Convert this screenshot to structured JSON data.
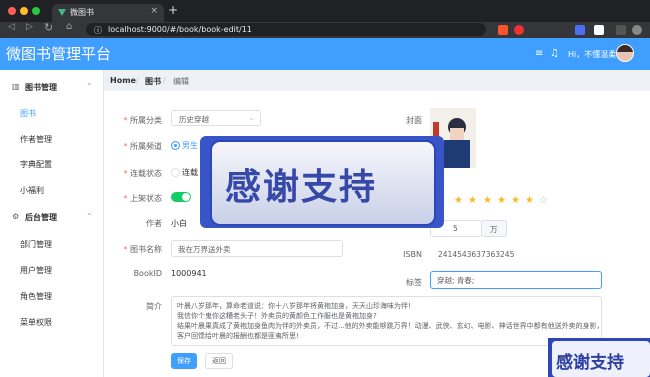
{
  "browser": {
    "tab_title": "微图书",
    "url": "localhost:9000/#/book/book-edit/11"
  },
  "header": {
    "brand": "微图书管理平台",
    "greeting": "Hi，不懂温柔"
  },
  "sidebar": {
    "groups": [
      {
        "title": "图书管理",
        "items": [
          "图书",
          "作者管理",
          "字典配置",
          "小福利"
        ]
      },
      {
        "title": "后台管理",
        "items": [
          "部门管理",
          "用户管理",
          "角色管理",
          "菜单权限"
        ]
      }
    ]
  },
  "breadcrumb": {
    "home": "Home",
    "level1": "图书",
    "level2": "编辑"
  },
  "form": {
    "category_label": "所属分类",
    "category_value": "历史穿越",
    "channel_label": "所属频道",
    "channel_value": "男生",
    "status_label": "连载状态",
    "status_value": "连载",
    "shelf_label": "上架状态",
    "author_label": "作者",
    "author_value": "小白",
    "name_label": "图书名称",
    "name_value": "我在万界送外卖",
    "bookid_label": "BookID",
    "bookid_value": "1000941",
    "intro_label": "简介",
    "intro_lines": [
      "叶晨八岁那年，算命老道说：你十八岁那年将黄袍加身，天天山珍海味为伴!",
      "我信你个鬼你这糟老头子！外卖员的黄颜色工作服也是黄袍加身?",
      "结果叶晨果真成了黄袍加身鱼肉为伴的外卖员，不过...他的外卖能够跳万界！动漫、武侠、玄幻、电影、神话世界中都有他送外卖的身影，",
      "客户回馈给叶晨的报酬也都是匪夷所思!"
    ],
    "cover_label": "封面",
    "words_value": "5",
    "words_unit": "万",
    "isbn_label": "ISBN",
    "isbn_value": "2414543637363245",
    "tags_label": "标签",
    "tags_value": "穿越; 青春;",
    "rating": 4,
    "save_button": "保存",
    "back_button": "返回"
  },
  "overlay": {
    "text": "感谢支持",
    "small_text": "感谢支持"
  },
  "colors": {
    "primary": "#409eff",
    "success": "#13ce66",
    "danger": "#f56c6c",
    "star": "#f7ba2a"
  }
}
